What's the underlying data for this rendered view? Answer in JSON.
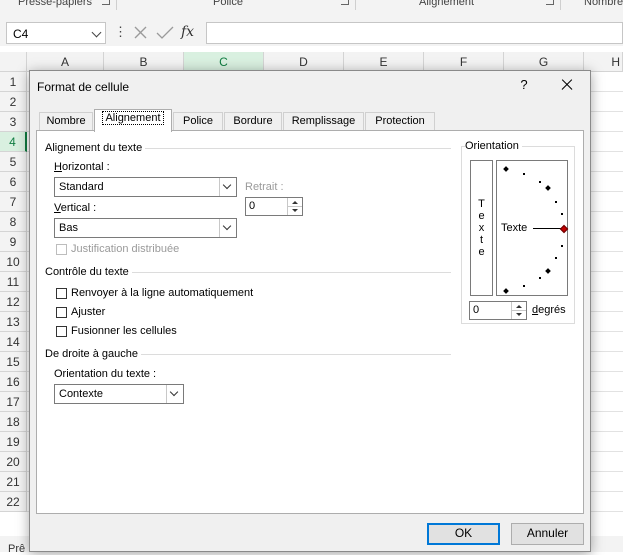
{
  "ribbon": {
    "groups": [
      "Presse-papiers",
      "Police",
      "Alignement",
      "Nombre"
    ]
  },
  "formula_bar": {
    "name_box": "C4",
    "fx_label": "fx",
    "formula": ""
  },
  "grid": {
    "columns": [
      "A",
      "B",
      "C",
      "D",
      "E",
      "F",
      "G",
      "H"
    ],
    "selected_column": "C",
    "rows": [
      "1",
      "2",
      "3",
      "4",
      "5",
      "6",
      "7",
      "8",
      "9",
      "10",
      "11",
      "12",
      "13",
      "14",
      "15",
      "16",
      "17",
      "18",
      "19",
      "20",
      "21",
      "22"
    ],
    "selected_row": "4"
  },
  "status": {
    "text": "Prê"
  },
  "dialog": {
    "title": "Format de cellule",
    "help": "?",
    "tabs": [
      "Nombre",
      "Alignement",
      "Police",
      "Bordure",
      "Remplissage",
      "Protection"
    ],
    "active_tab": "Alignement",
    "text_alignment": {
      "group_title": "Alignement du texte",
      "horizontal_label": "Horizontal :",
      "horizontal_value": "Standard",
      "vertical_label": "Vertical :",
      "vertical_value": "Bas",
      "indent_label": "Retrait :",
      "indent_value": "0",
      "justify_distributed_label": "Justification distribuée"
    },
    "text_control": {
      "group_title": "Contrôle du texte",
      "wrap_label": "Renvoyer à la ligne automatiquement",
      "shrink_label": "Ajuster",
      "merge_label": "Fusionner les cellules"
    },
    "rtl": {
      "group_title": "De droite à gauche",
      "direction_label": "Orientation du texte :",
      "direction_value": "Contexte"
    },
    "orientation": {
      "group_title": "Orientation",
      "vertical_text": [
        "T",
        "e",
        "x",
        "t",
        "e"
      ],
      "dial_text": "Texte",
      "degrees_value": "0",
      "degrees_label": "degrés",
      "needle_color": "#c00000"
    },
    "ok_label": "OK",
    "cancel_label": "Annuler"
  }
}
